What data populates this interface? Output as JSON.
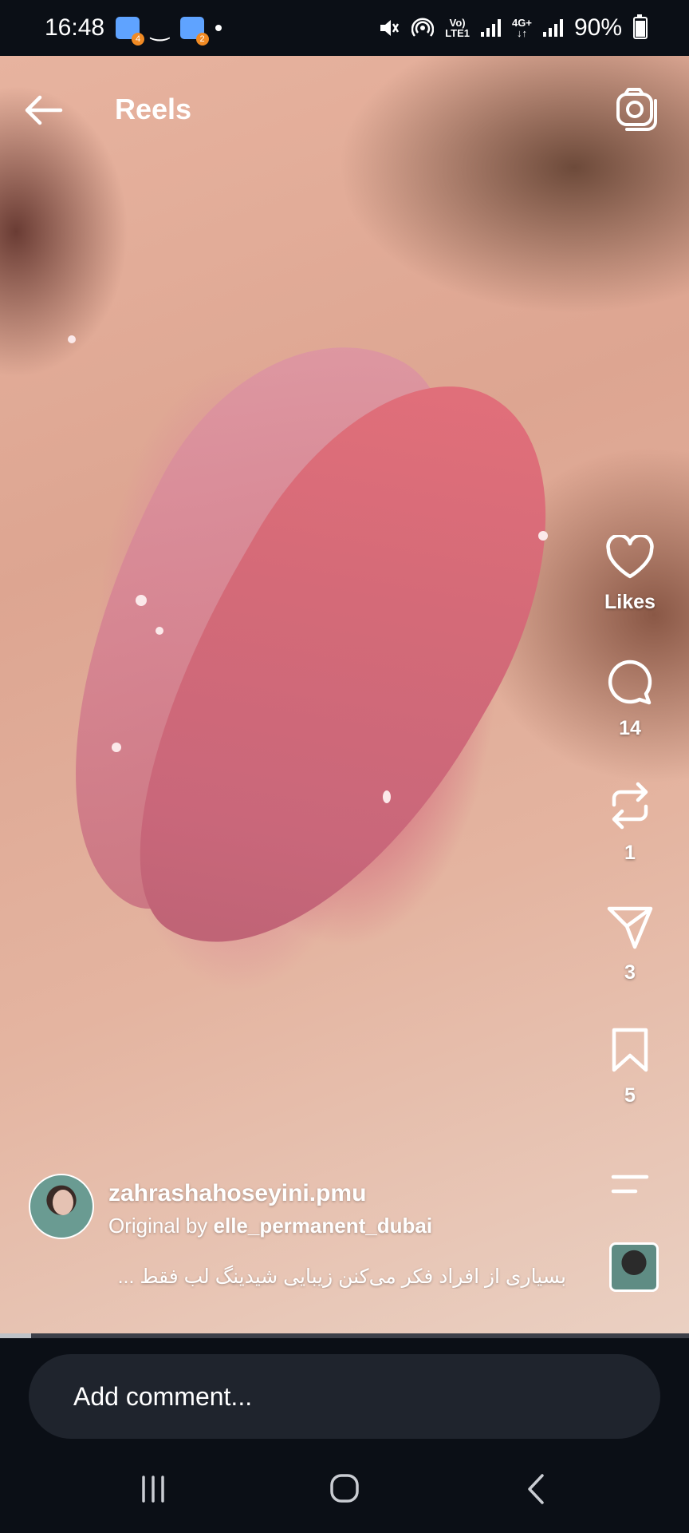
{
  "status_bar": {
    "time": "16:48",
    "notif_badge_1": "4",
    "notif_badge_2": "2",
    "network_top": "Vo)",
    "network_bottom": "LTE1",
    "network2_top": "4G+",
    "network2_bottom": "↓↑",
    "battery": "90%",
    "battery_level": 0.9
  },
  "header": {
    "title": "Reels"
  },
  "actions": {
    "likes_label": "Likes",
    "comments_count": "14",
    "reposts_count": "1",
    "shares_count": "3",
    "saves_count": "5"
  },
  "author": {
    "username": "zahrashahoseyini.pmu",
    "original_prefix": "Original by",
    "original_author": "elle_permanent_dubai",
    "caption": "بسیاری از افراد فکر می‌کنن زیبایی شیدینگ لب فقط ..."
  },
  "playback": {
    "progress": 0.045
  },
  "comment": {
    "placeholder": "Add comment..."
  },
  "icons": [
    "back-arrow-icon",
    "camera-icon",
    "heart-icon",
    "comment-icon",
    "repost-icon",
    "send-icon",
    "bookmark-icon",
    "more-icon",
    "audio-thumbnail",
    "recents-icon",
    "home-icon",
    "back-nav-icon"
  ]
}
